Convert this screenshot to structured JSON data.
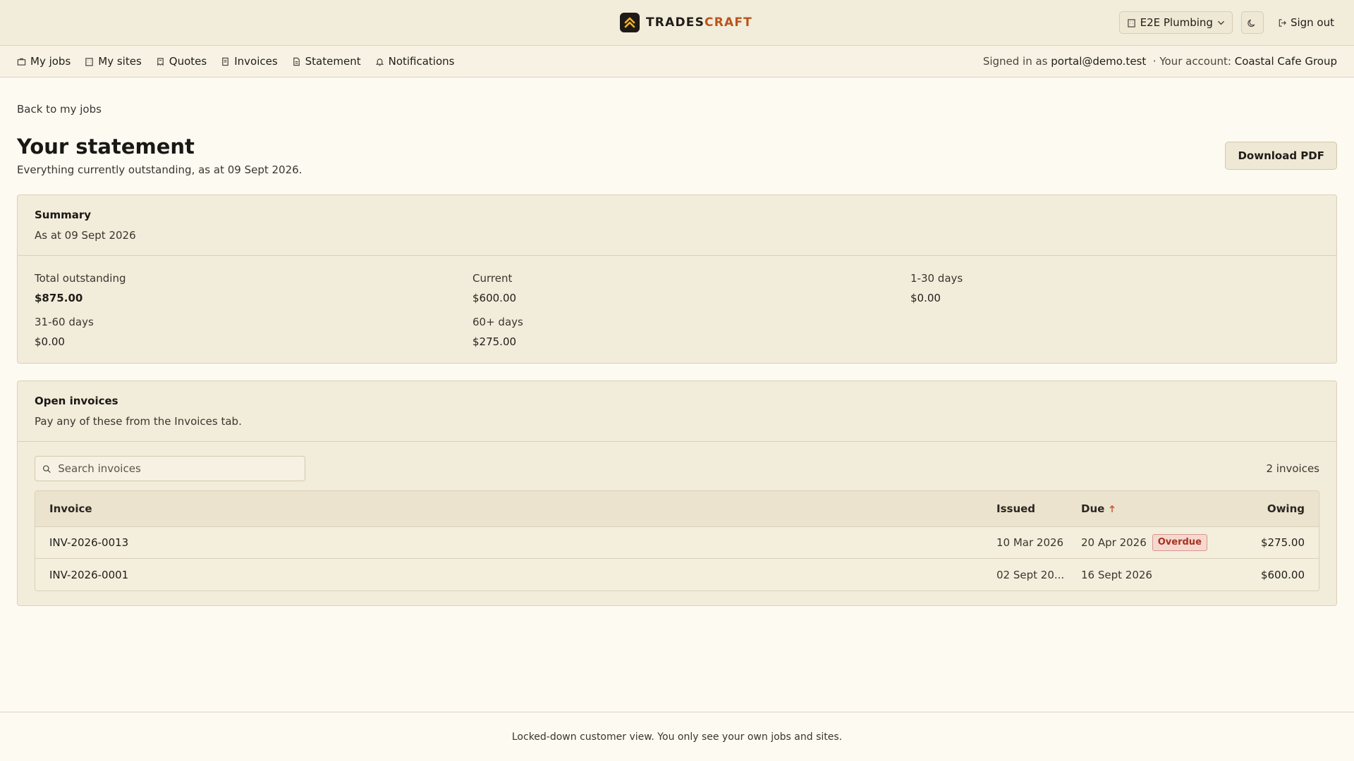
{
  "brand": {
    "name_part1": "TRADES",
    "name_part2": "CRAFT",
    "accent_color": "#b8541d"
  },
  "header": {
    "org_selector": "E2E Plumbing",
    "theme_toggle_icon": "moon-icon",
    "sign_out_label": "Sign out"
  },
  "nav": {
    "items": [
      {
        "label": "My jobs",
        "icon": "briefcase-icon"
      },
      {
        "label": "My sites",
        "icon": "building-icon"
      },
      {
        "label": "Quotes",
        "icon": "quote-icon"
      },
      {
        "label": "Invoices",
        "icon": "receipt-icon"
      },
      {
        "label": "Statement",
        "icon": "document-icon"
      },
      {
        "label": "Notifications",
        "icon": "bell-icon"
      }
    ],
    "signed_in_prefix": "Signed in as",
    "signed_in_email": "portal@demo.test",
    "account_prefix": "· Your account:",
    "account_name": "Coastal Cafe Group"
  },
  "page": {
    "back_link": "Back to my jobs",
    "title": "Your statement",
    "subtitle": "Everything currently outstanding, as at 09 Sept 2026.",
    "download_label": "Download PDF"
  },
  "summary": {
    "title": "Summary",
    "subtitle": "As at 09 Sept 2026",
    "metrics": [
      {
        "label": "Total outstanding",
        "value": "$875.00"
      },
      {
        "label": "Current",
        "value": "$600.00"
      },
      {
        "label": "1-30 days",
        "value": "$0.00"
      },
      {
        "label": "31-60 days",
        "value": "$0.00"
      },
      {
        "label": "60+ days",
        "value": "$275.00"
      }
    ]
  },
  "open_invoices": {
    "title": "Open invoices",
    "subtitle": "Pay any of these from the Invoices tab.",
    "search_placeholder": "Search invoices",
    "count_label": "2 invoices",
    "columns": {
      "invoice": "Invoice",
      "issued": "Issued",
      "due": "Due",
      "owing": "Owing"
    },
    "rows": [
      {
        "invoice": "INV-2026-0013",
        "issued": "10 Mar 2026",
        "due": "20 Apr 2026",
        "badge": "Overdue",
        "owing": "$275.00"
      },
      {
        "invoice": "INV-2026-0001",
        "issued": "02 Sept 20...",
        "due": "16 Sept 2026",
        "badge": "",
        "owing": "$600.00"
      }
    ]
  },
  "footer": {
    "text": "Locked-down customer view. You only see your own jobs and sites."
  }
}
